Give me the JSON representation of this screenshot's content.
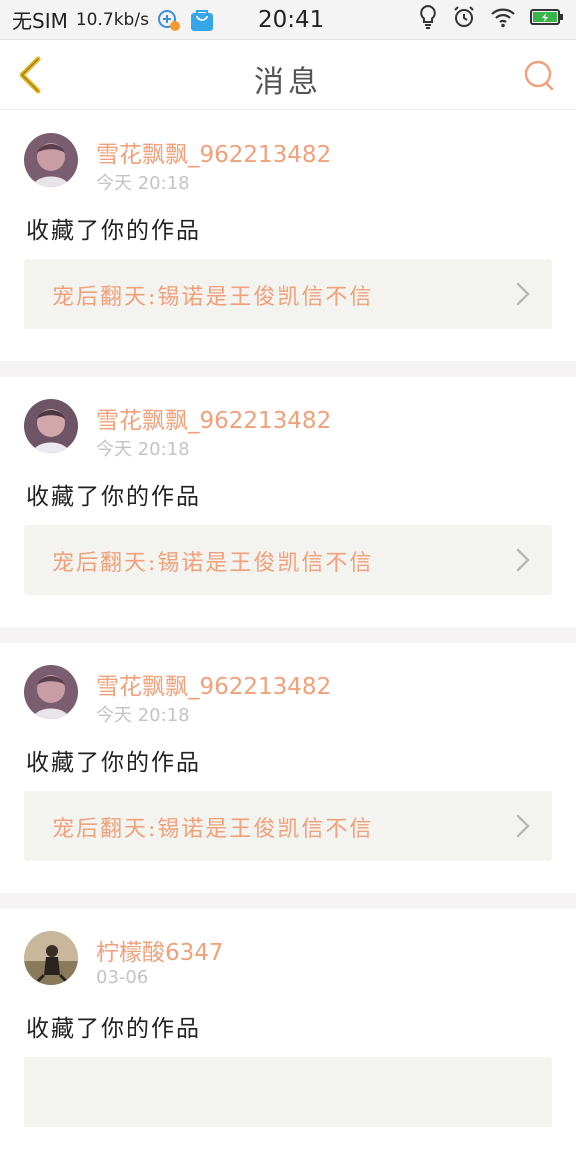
{
  "status_bar": {
    "carrier": "无SIM",
    "speed": "10.7kb/s",
    "time": "20:41",
    "icons": [
      "data-saver-badge-icon",
      "app-store-icon",
      "bulb-icon",
      "alarm-icon",
      "wifi-icon",
      "battery-charging-icon"
    ]
  },
  "header": {
    "title": "消息",
    "back_icon": "chevron-left-icon",
    "search_icon": "search-icon"
  },
  "colors": {
    "accent": "#f0a07a",
    "back_icon": "#e8b820",
    "work_bg": "#f3f3ef",
    "divider": "#f5f3f3"
  },
  "messages": [
    {
      "user": "雪花飘飘_962213482",
      "time": "今天 20:18",
      "action": "收藏了你的作品",
      "work": "宠后翻天:锡诺是王俊凯信不信"
    },
    {
      "user": "雪花飘飘_962213482",
      "time": "今天 20:18",
      "action": "收藏了你的作品",
      "work": "宠后翻天:锡诺是王俊凯信不信"
    },
    {
      "user": "雪花飘飘_962213482",
      "time": "今天 20:18",
      "action": "收藏了你的作品",
      "work": "宠后翻天:锡诺是王俊凯信不信"
    },
    {
      "user": "柠檬酸6347",
      "time": "03-06",
      "action": "收藏了你的作品",
      "work": ""
    }
  ]
}
